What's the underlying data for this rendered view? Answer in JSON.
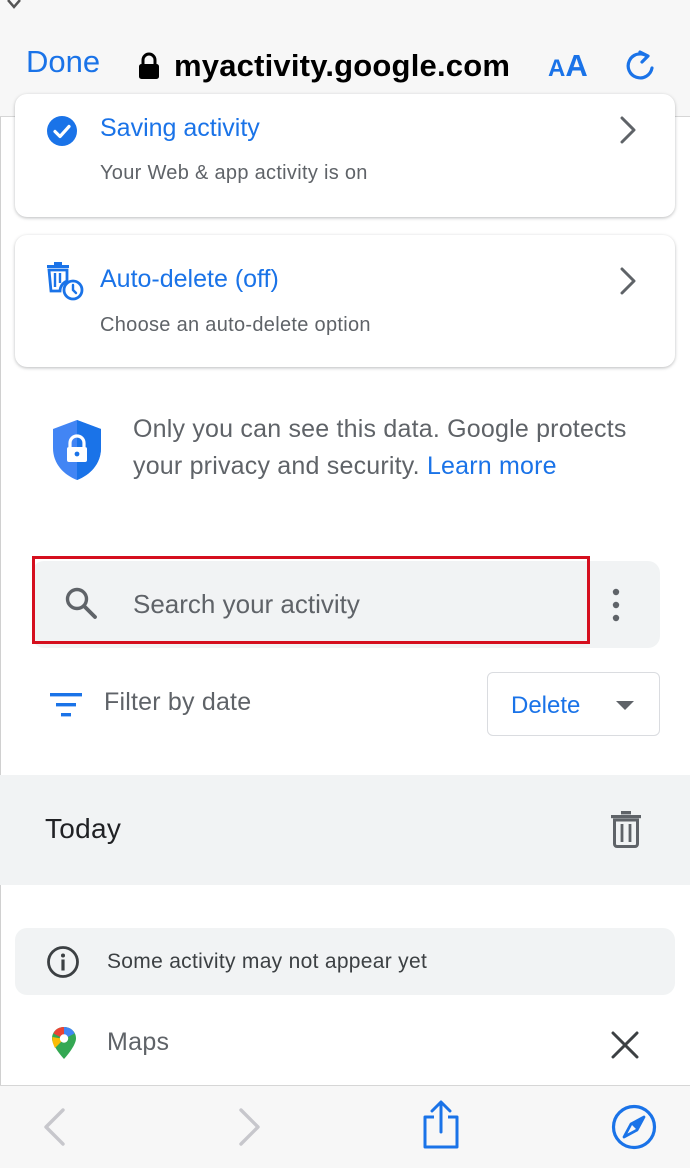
{
  "browser": {
    "done_label": "Done",
    "url": "myactivity.google.com",
    "text_size_small": "A",
    "text_size_large": "A"
  },
  "cards": {
    "saving": {
      "title": "Saving activity",
      "subtitle": "Your Web & app activity is on"
    },
    "auto_delete": {
      "title": "Auto-delete (off)",
      "subtitle": "Choose an auto-delete option"
    }
  },
  "privacy": {
    "text": "Only you can see this data. Google protects your privacy and security. ",
    "link": "Learn more"
  },
  "search": {
    "placeholder": "Search your activity"
  },
  "filter": {
    "label": "Filter by date",
    "delete_label": "Delete"
  },
  "today": {
    "label": "Today"
  },
  "notice": {
    "text": "Some activity may not appear yet"
  },
  "items": [
    {
      "label": "Maps"
    }
  ],
  "colors": {
    "accent": "#1a73e8",
    "highlight_border": "#d50f1e",
    "muted_text": "#5f6368",
    "panel_bg": "#f1f3f4"
  }
}
